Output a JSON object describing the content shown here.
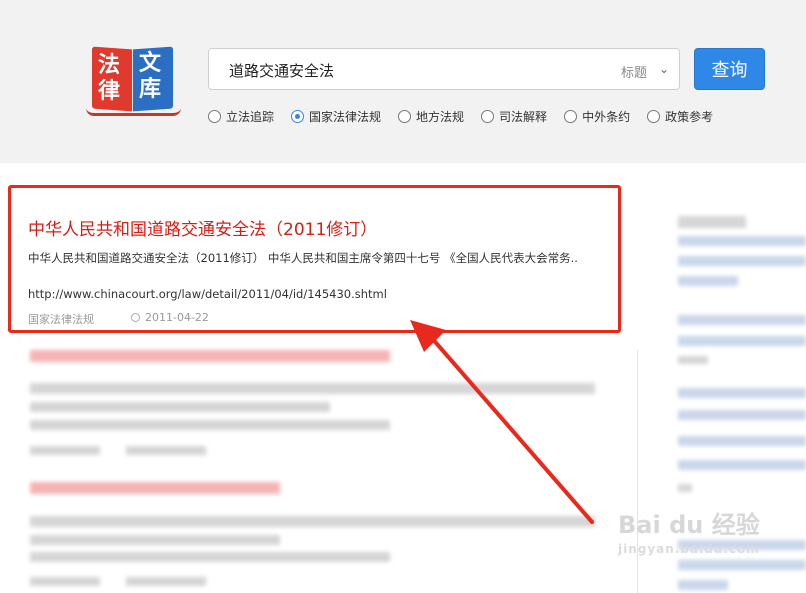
{
  "logo": {
    "chars": [
      "法",
      "文",
      "律",
      "库"
    ]
  },
  "search": {
    "query": "道路交通安全法",
    "scope": "标题",
    "submit_label": "查询"
  },
  "filters": {
    "options": [
      {
        "label": "立法追踪",
        "checked": false
      },
      {
        "label": "国家法律法规",
        "checked": true
      },
      {
        "label": "地方法规",
        "checked": false
      },
      {
        "label": "司法解释",
        "checked": false
      },
      {
        "label": "中外条约",
        "checked": false
      },
      {
        "label": "政策参考",
        "checked": false
      }
    ]
  },
  "result": {
    "title": "中华人民共和国道路交通安全法（2011修订）",
    "snippet": "中华人民共和国道路交通安全法（2011修订） 中华人民共和国主席令第四十七号 《全国人民代表大会常务..",
    "url": "http://www.chinacourt.org/law/detail/2011/04/id/145430.shtml",
    "category": "国家法律法规",
    "date": "2011-04-22"
  },
  "colors": {
    "accent": "#2f87e6",
    "highlight": "#e8291c",
    "title": "#d81e14"
  },
  "watermark": {
    "brand": "Bai du 经验",
    "domain": "jingyan.baidu.com"
  }
}
